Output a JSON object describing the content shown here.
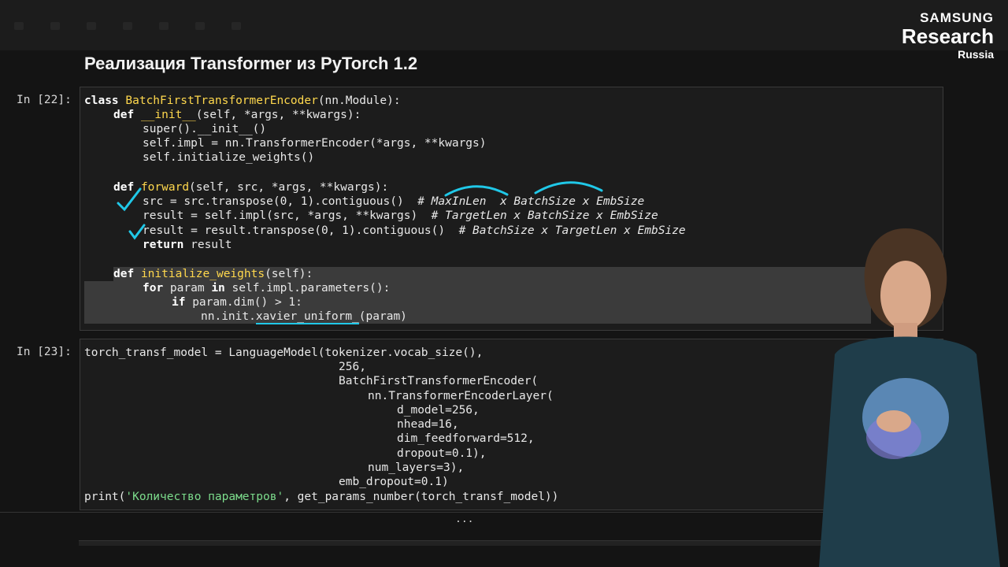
{
  "logo": {
    "line1": "SAMSUNG",
    "line2": "Research",
    "line3": "Russia"
  },
  "notebook_title": "Реализация Transformer из PyTorch 1.2",
  "cell1": {
    "prompt": "In [22]:",
    "lines": {
      "l1_kw": "class",
      "l1_name": "BatchFirstTransformerEncoder",
      "l1_rest": "(nn.Module):",
      "l2_kw": "def",
      "l2_name": "__init__",
      "l2_rest": "(self, *args, **kwargs):",
      "l3": "super().__init__()",
      "l4": "self.impl = nn.TransformerEncoder(*args, **kwargs)",
      "l5": "self.initialize_weights()",
      "l6_kw": "def",
      "l6_name": "forward",
      "l6_rest": "(self, src, *args, **kwargs):",
      "l7_code": "src = src.transpose(0, 1).contiguous()  ",
      "l7_cmt": "# MaxInLen  x BatchSize x EmbSize",
      "l8_code": "result = self.impl(src, *args, **kwargs)  ",
      "l8_cmt": "# TargetLen x BatchSize x EmbSize",
      "l9_code": "result = result.transpose(0, 1).contiguous()  ",
      "l9_cmt": "# BatchSize x TargetLen x EmbSize",
      "l10_kw": "return",
      "l10_rest": " result",
      "l11_kw": "def",
      "l11_name": "initialize_weights",
      "l11_rest": "(self):",
      "l12_kw1": "for",
      "l12_mid": " param ",
      "l12_kw2": "in",
      "l12_rest": " self.impl.parameters():",
      "l13_kw": "if",
      "l13_rest": " param.dim() > 1:",
      "l14_pre": "nn.init.",
      "l14_ul": "xavier_uniform_",
      "l14_post": "(param)"
    }
  },
  "cell2": {
    "prompt": "In [23]:",
    "lines": {
      "l1": "torch_transf_model = LanguageModel(tokenizer.vocab_size(),",
      "l2": "256,",
      "l3": "BatchFirstTransformerEncoder(",
      "l4": "nn.TransformerEncoderLayer(",
      "l5": "d_model=256,",
      "l6": "nhead=16,",
      "l7": "dim_feedforward=512,",
      "l8": "dropout=0.1),",
      "l9": "num_layers=3),",
      "l10": "emb_dropout=0.1)",
      "l11_pre": "print(",
      "l11_str": "'Количество параметров'",
      "l11_post": ", get_params_number(torch_transf_model))"
    }
  },
  "ellipsis": "...",
  "colors": {
    "background": "#141414",
    "cell_background": "#1c1c1c",
    "highlight": "#3b3b3b",
    "annotation": "#20c8e8",
    "function_name": "#ffd84d",
    "string": "#7cdc8c"
  }
}
